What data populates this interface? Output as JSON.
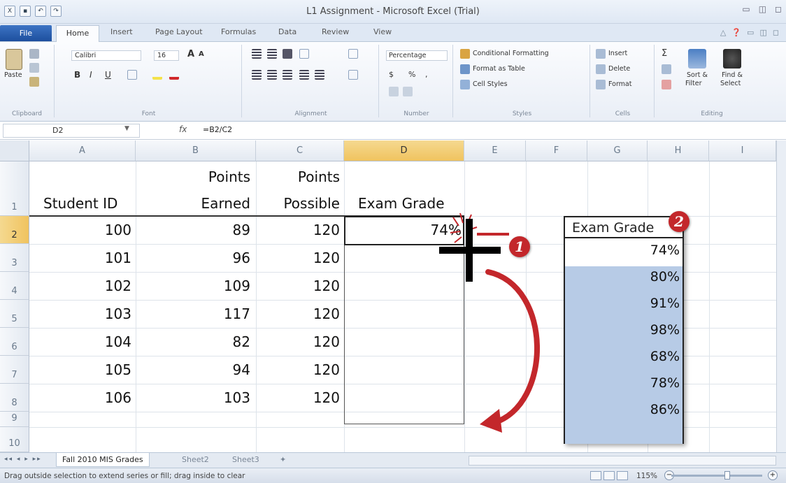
{
  "window": {
    "title": "L1 Assignment - Microsoft Excel (Trial)"
  },
  "ribbon_tabs": [
    "File",
    "Home",
    "Insert",
    "Page Layout",
    "Formulas",
    "Data",
    "Review",
    "View"
  ],
  "ribbon": {
    "clipboard": {
      "paste": "Paste",
      "label": "Clipboard"
    },
    "font": {
      "name": "Calibri",
      "size": "16",
      "label": "Font",
      "bold": "B",
      "italic": "I",
      "underline": "U"
    },
    "alignment": {
      "label": "Alignment"
    },
    "number": {
      "format": "Percentage",
      "label": "Number",
      "currency": "$",
      "percent": "%",
      "comma": ","
    },
    "styles": {
      "conditional": "Conditional Formatting",
      "format_table": "Format as Table",
      "cell_styles": "Cell Styles",
      "label": "Styles"
    },
    "cells": {
      "insert": "Insert",
      "delete": "Delete",
      "format": "Format",
      "label": "Cells"
    },
    "editing": {
      "sum": "Σ",
      "sort": "Sort &",
      "filter": "Filter",
      "find": "Find &",
      "select": "Select",
      "label": "Editing"
    }
  },
  "formula_bar": {
    "name_box": "D2",
    "fx": "fx",
    "formula": "=B2/C2"
  },
  "columns": [
    "A",
    "B",
    "C",
    "D",
    "E",
    "F",
    "G",
    "H",
    "I"
  ],
  "rows": [
    "1",
    "2",
    "3",
    "4",
    "5",
    "6",
    "7",
    "8",
    "9",
    "10"
  ],
  "sheet": {
    "header": {
      "a": "Student ID",
      "b_top": "Points",
      "b_bottom": "Earned",
      "c_top": "Points",
      "c_bottom": "Possible",
      "d": "Exam Grade"
    },
    "data_rows": [
      {
        "id": "100",
        "earned": "89",
        "possible": "120"
      },
      {
        "id": "101",
        "earned": "96",
        "possible": "120"
      },
      {
        "id": "102",
        "earned": "109",
        "possible": "120"
      },
      {
        "id": "103",
        "earned": "117",
        "possible": "120"
      },
      {
        "id": "104",
        "earned": "82",
        "possible": "120"
      },
      {
        "id": "105",
        "earned": "94",
        "possible": "120"
      },
      {
        "id": "106",
        "earned": "103",
        "possible": "120"
      }
    ],
    "d2_value": "74%"
  },
  "callout": {
    "header": "Exam Grade",
    "values": [
      "74%",
      "80%",
      "91%",
      "98%",
      "68%",
      "78%",
      "86%"
    ]
  },
  "badges": [
    "1",
    "2"
  ],
  "sheet_tabs": [
    "Fall 2010 MIS Grades",
    "Sheet2",
    "Sheet3"
  ],
  "status": {
    "message": "Drag outside selection to extend series or fill; drag inside to clear",
    "zoom": "115%"
  },
  "colors": {
    "badge": "#c3272b",
    "selection_fill": "#b7cbe6",
    "arrow": "#c3272b"
  }
}
